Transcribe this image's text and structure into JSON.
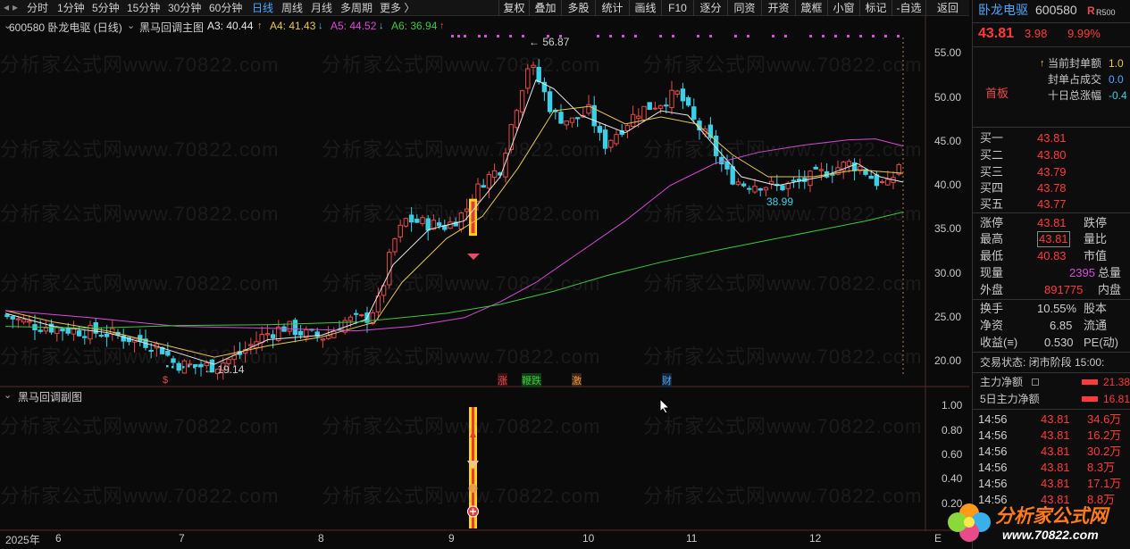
{
  "toolbar": {
    "periods": [
      "分时",
      "1分钟",
      "5分钟",
      "15分钟",
      "30分钟",
      "60分钟",
      "日线",
      "周线",
      "月线",
      "多周期",
      "更多 〉"
    ],
    "active_period": "日线",
    "buttons": [
      "复权",
      "叠加",
      "多股",
      "统计",
      "画线",
      "F10",
      "逐分",
      "同资",
      "开资",
      "箴框",
      "小窗",
      "标记",
      "-自选",
      "返回"
    ]
  },
  "main_legend": {
    "code_name": "600580 卧龙电驱 (日线)",
    "indicator": "黑马回调主图",
    "a3_label": "A3: 40.44",
    "a4_label": "A4: 41.43",
    "a5_label": "A5: 44.52",
    "a6_label": "A6: 36.94",
    "a3_color": "#e8e8e8",
    "a4_color": "#e8c84a",
    "a5_color": "#d84ad8",
    "a6_color": "#3cc83c"
  },
  "sub_legend": {
    "indicator": "黑马回调副图"
  },
  "watermark": "分析家公式网www.70822.com",
  "price_axis": [
    "55.00",
    "50.00",
    "45.00",
    "40.00",
    "35.00",
    "30.00",
    "25.00",
    "20.00"
  ],
  "sub_axis": [
    "1.00",
    "0.80",
    "0.60",
    "0.40",
    "0.20"
  ],
  "date_axis": [
    "2025年",
    "6",
    "7",
    "8",
    "9",
    "10",
    "11",
    "12",
    "E"
  ],
  "annotations": {
    "high": "56.87",
    "low": "19.14",
    "mid_low": "38.99",
    "markers": [
      "$",
      "涨",
      "鞭跌",
      "激",
      "财"
    ]
  },
  "quote": {
    "name": "卧龙电驱",
    "code": "600580",
    "tag": "R500",
    "price": "43.81",
    "change": "3.98",
    "change_pct": "9.99%",
    "board_label": "首板",
    "limit_info": [
      {
        "label": "当前封单额",
        "value": "1.0"
      },
      {
        "label": "封单占成交",
        "value": "0.0"
      },
      {
        "label": "十日总涨幅",
        "value": "-0.4"
      }
    ],
    "bids": [
      {
        "label": "买一",
        "price": "43.81"
      },
      {
        "label": "买二",
        "price": "43.80"
      },
      {
        "label": "买三",
        "price": "43.79"
      },
      {
        "label": "买四",
        "price": "43.78"
      },
      {
        "label": "买五",
        "price": "43.77"
      }
    ],
    "stats1": [
      {
        "label": "涨停",
        "value": "43.81",
        "label2": "跌停"
      },
      {
        "label": "最高",
        "value": "43.81",
        "label2": "量比"
      },
      {
        "label": "最低",
        "value": "40.83",
        "label2": "市值"
      },
      {
        "label": "现量",
        "value": "2395",
        "label2": "总量"
      },
      {
        "label": "外盘",
        "value": "891775",
        "label2": "内盘"
      }
    ],
    "stats2": [
      {
        "label": "换手",
        "value": "10.55%",
        "label2": "股本"
      },
      {
        "label": "净资",
        "value": "6.85",
        "label2": "流通"
      },
      {
        "label": "收益(≡)",
        "value": "0.530",
        "label2": "PE(动)"
      }
    ],
    "trade_status": "交易状态: 闭市阶段 15:00:",
    "flows": [
      {
        "label": "主力净额",
        "value": "21.38"
      },
      {
        "label": "5日主力净额",
        "value": "16.81"
      }
    ],
    "ticks": [
      {
        "time": "14:56",
        "price": "43.81",
        "vol": "34.6万"
      },
      {
        "time": "14:56",
        "price": "43.81",
        "vol": "16.2万"
      },
      {
        "time": "14:56",
        "price": "43.81",
        "vol": "30.2万"
      },
      {
        "time": "14:56",
        "price": "43.81",
        "vol": "8.3万"
      },
      {
        "time": "14:56",
        "price": "43.81",
        "vol": "17.1万"
      },
      {
        "time": "14:56",
        "price": "43.81",
        "vol": "8.8万"
      }
    ]
  },
  "logo": {
    "text": "分析家公式网",
    "url": "www.70822.com"
  }
}
